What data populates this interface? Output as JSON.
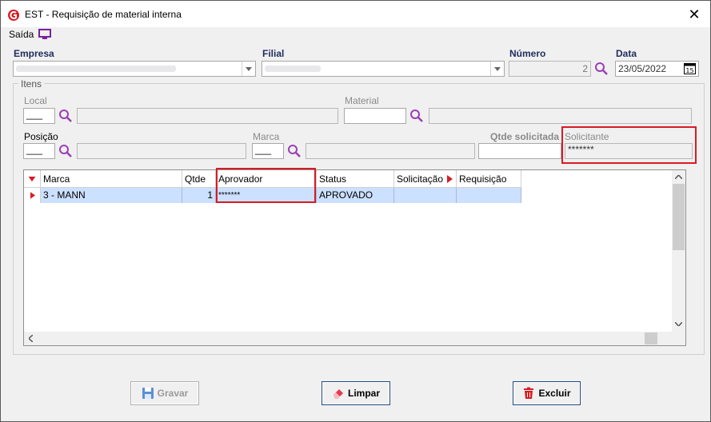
{
  "window": {
    "title": "EST - Requisição de material interna",
    "close_glyph": "✕"
  },
  "menu": {
    "saida_label": "Saída",
    "icon": "monitor-icon"
  },
  "header": {
    "empresa_label": "Empresa",
    "filial_label": "Filial",
    "numero_label": "Número",
    "numero_value": "2",
    "data_label": "Data",
    "data_value": "23/05/2022",
    "date_icon_text": "15"
  },
  "itens": {
    "group_title": "Itens",
    "local_label": "Local",
    "local_value": "___",
    "material_label": "Material",
    "posicao_label": "Posição",
    "posicao_value": "___",
    "marca_label": "Marca",
    "marca_value": "___",
    "qtde_solicitada_label": "Qtde solicitada",
    "solicitante_label": "Solicitante",
    "solicitante_value": "*******"
  },
  "grid": {
    "columns": [
      "Marca",
      "Qtde",
      "Aprovador",
      "Status",
      "Solicitação",
      "Requisição"
    ],
    "rows": [
      {
        "marca": "3 - MANN",
        "qtde": "1",
        "aprovador": "*******",
        "status": "APROVADO",
        "solicitacao": "",
        "requisicao": ""
      }
    ]
  },
  "buttons": {
    "gravar": "Gravar",
    "limpar": "Limpar",
    "excluir": "Excluir"
  },
  "colors": {
    "accent": "#7a1fa2",
    "highlight": "#d91b23",
    "selection": "#cce0ff"
  }
}
